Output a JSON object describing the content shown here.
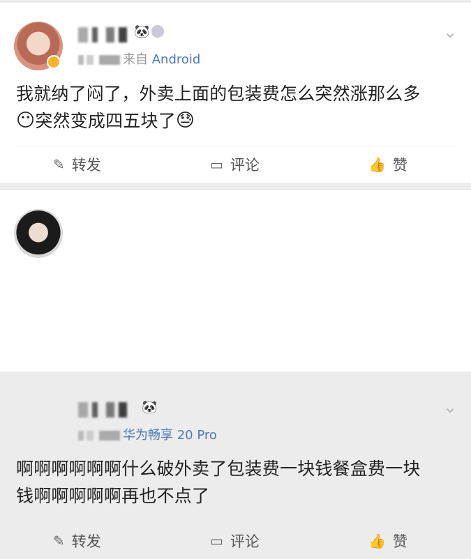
{
  "posts": [
    {
      "meta": {
        "prefix": "来自",
        "device": " Android"
      },
      "content": {
        "line1": "我就纳了闷了，外卖上面的包装费怎么突然涨那么多",
        "line2_prefix_emoji": "😶",
        "line2_text": "突然变成四五块了",
        "line2_suffix_emoji": "😓"
      },
      "actions": {
        "repost": "转发",
        "comment": "评论",
        "like": "赞"
      }
    },
    {
      "meta": {
        "prefix": "华为",
        "device": "畅享 20 Pro"
      },
      "content": {
        "line1": "啊啊啊啊啊啊什么破外卖了包装费一块钱餐盒费一块",
        "line2_text": "钱啊啊啊啊啊再也不点了"
      },
      "actions": {
        "repost": "转发",
        "comment": "评论",
        "like": "赞"
      }
    }
  ],
  "icons": {
    "repost": "edit-share-icon",
    "comment": "comment-icon",
    "like": "thumbs-up-icon",
    "more": "chevron-down-icon",
    "panda": "panda-icon",
    "medal": "medal-icon"
  }
}
